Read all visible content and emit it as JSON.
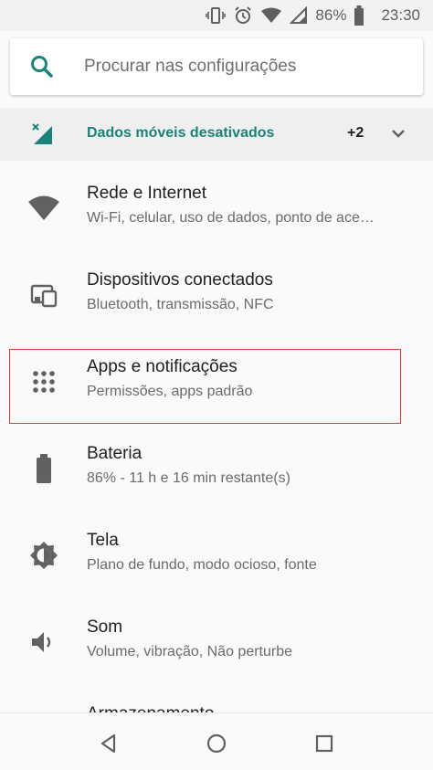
{
  "status_bar": {
    "battery_percent": "86%",
    "time": "23:30",
    "icons": [
      "vibrate-icon",
      "alarm-icon",
      "wifi-icon",
      "signal-icon",
      "battery-icon"
    ]
  },
  "search": {
    "placeholder": "Procurar nas configurações"
  },
  "banner": {
    "title": "Dados móveis desativados",
    "count": "+2"
  },
  "items": [
    {
      "title": "Rede e Internet",
      "subtitle": "Wi-Fi, celular, uso de dados, ponto de ace…",
      "icon": "wifi-icon"
    },
    {
      "title": "Dispositivos conectados",
      "subtitle": "Bluetooth, transmissão, NFC",
      "icon": "devices-icon"
    },
    {
      "title": "Apps e notificações",
      "subtitle": "Permissões, apps padrão",
      "icon": "apps-icon"
    },
    {
      "title": "Bateria",
      "subtitle": "86% - 11 h e 16 min restante(s)",
      "icon": "battery-icon"
    },
    {
      "title": "Tela",
      "subtitle": "Plano de fundo, modo ocioso, fonte",
      "icon": "brightness-icon"
    },
    {
      "title": "Som",
      "subtitle": "Volume, vibração, Não perturbe",
      "icon": "volume-icon"
    },
    {
      "title": "Armazenamento",
      "subtitle": "",
      "icon": "storage-icon"
    }
  ],
  "colors": {
    "accent": "#19857a",
    "highlight": "#e53935"
  }
}
